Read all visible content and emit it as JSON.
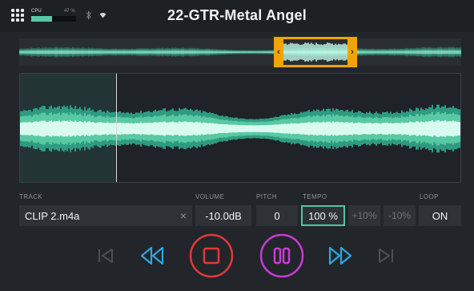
{
  "header": {
    "title": "22-GTR-Metal Angel",
    "cpu_label": "CPU",
    "cpu_percent": "47 %",
    "cpu_level": 0.47
  },
  "controls": {
    "track": {
      "label": "TRACK",
      "value": "CLIP 2.m4a"
    },
    "volume": {
      "label": "VOLUME",
      "value": "-10.0dB"
    },
    "pitch": {
      "label": "PITCH",
      "value": "0"
    },
    "tempo": {
      "label": "TEMPO",
      "value": "100 %",
      "plus": "+10%",
      "minus": "-10%"
    },
    "loop": {
      "label": "LOOP",
      "value": "ON"
    }
  },
  "colors": {
    "accent": "#58c9a3",
    "selection": "#f3a300",
    "stop": "#e03a3a",
    "pause": "#c93bd6",
    "transport": "#2aa7e0"
  },
  "icons": [
    "grid-menu-icon",
    "bluetooth-icon",
    "wifi-icon",
    "clear-icon",
    "skip-to-start-icon",
    "rewind-icon",
    "stop-icon",
    "pause-icon",
    "fast-forward-icon",
    "skip-to-end-icon"
  ]
}
